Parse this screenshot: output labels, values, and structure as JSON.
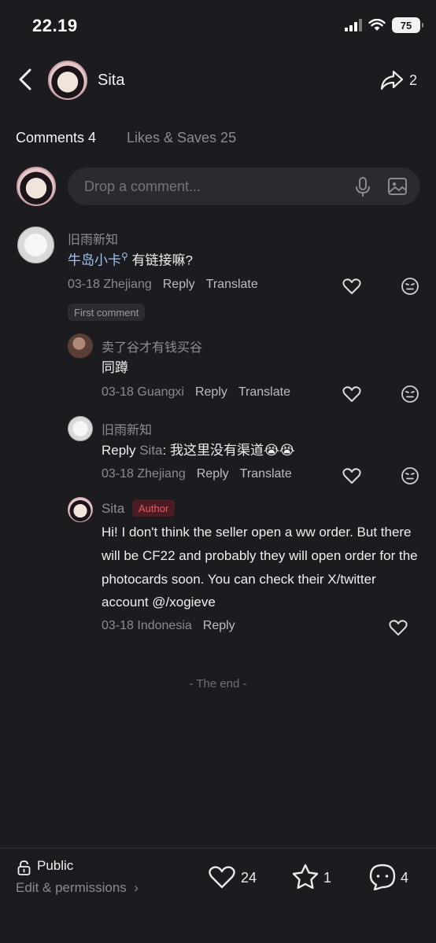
{
  "status_bar": {
    "time": "22.19",
    "battery": "75"
  },
  "header": {
    "name": "Sita",
    "share_count": "2"
  },
  "tabs": [
    {
      "label": "Comments 4",
      "active": true
    },
    {
      "label": "Likes & Saves 25",
      "active": false
    }
  ],
  "comment_input": {
    "placeholder": "Drop a comment..."
  },
  "comments": [
    {
      "user": "旧雨新知",
      "mention": "牛岛小卡",
      "text": "有链接嘛?",
      "date": "03-18",
      "location": "Zhejiang",
      "reply_label": "Reply",
      "translate_label": "Translate",
      "tag": "First comment"
    },
    {
      "user": "卖了谷才有钱买谷",
      "text": "同蹲",
      "date": "03-18",
      "location": "Guangxi",
      "reply_label": "Reply",
      "translate_label": "Translate"
    },
    {
      "user": "旧雨新知",
      "reply_prefix": "Reply",
      "reply_to": "Sita",
      "text": ": 我这里没有渠道😭😭",
      "date": "03-18",
      "location": "Zhejiang",
      "reply_label": "Reply",
      "translate_label": "Translate"
    },
    {
      "user": "Sita",
      "badge": "Author",
      "text": "Hi! I don't think the seller open a ww order. But there will be CF22 and probably they will open order for the photocards soon. You can check their X/twitter account @/xogieve",
      "date": "03-18",
      "location": "Indonesia",
      "reply_label": "Reply"
    }
  ],
  "end_text": "- The end -",
  "bottom_bar": {
    "visibility": "Public",
    "permissions": "Edit & permissions",
    "likes": "24",
    "stars": "1",
    "comments": "4"
  },
  "colors": {
    "background": "#1b1b20",
    "link": "#9cc3f5",
    "author_badge": "#e85a62"
  }
}
